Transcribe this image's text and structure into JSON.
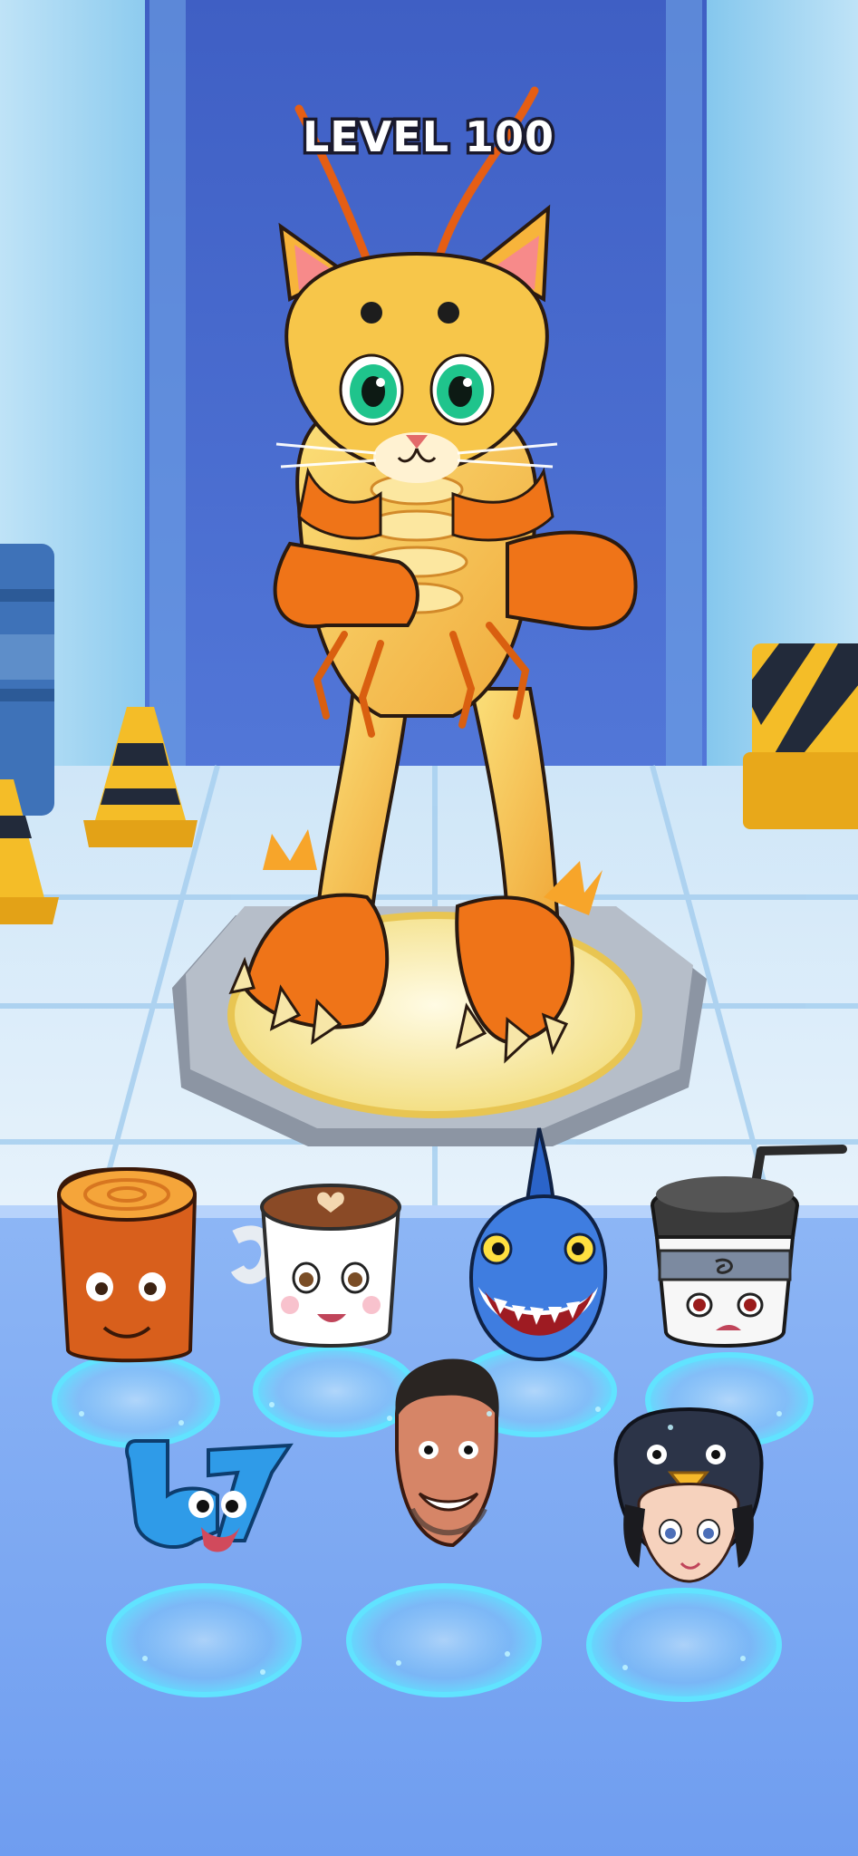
{
  "hud": {
    "level_label": "LEVEL 100"
  },
  "stage": {
    "featured_monster": "cat-shrimp-hybrid",
    "pedestal": "octagon-spawn-pad"
  },
  "heads": [
    {
      "slot": 1,
      "icon": "wood-log-head-icon"
    },
    {
      "slot": 2,
      "icon": "coffee-cup-head-icon"
    },
    {
      "slot": 3,
      "icon": "shark-head-icon"
    },
    {
      "slot": 4,
      "icon": "drink-cup-ninja-head-icon"
    },
    {
      "slot": 5,
      "icon": "number-67-head-icon"
    },
    {
      "slot": 6,
      "icon": "grinning-man-head-icon"
    },
    {
      "slot": 7,
      "icon": "penguin-hood-girl-head-icon"
    }
  ],
  "colors": {
    "wall": "#4f6fcf",
    "floor": "#d7e9f8",
    "tray": "#7aa8f3",
    "pad_glow": "#5fe0ff",
    "monster_orange": "#f07a1e",
    "monster_yellow": "#f7c64a"
  }
}
